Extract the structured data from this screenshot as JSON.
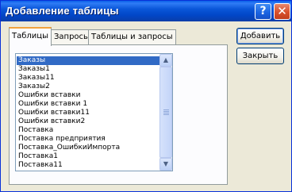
{
  "window": {
    "title": "Добавление таблицы",
    "help_label": "?",
    "close_label": "✕"
  },
  "tabs": [
    {
      "label": "Таблицы",
      "active": true
    },
    {
      "label": "Запросы",
      "active": false
    },
    {
      "label": "Таблицы и запросы",
      "active": false
    }
  ],
  "list": {
    "items": [
      "Заказы",
      "Заказы1",
      "Заказы11",
      "Заказы2",
      "Ошибки вставки",
      "Ошибки вставки 1",
      "Ошибки вставки11",
      "Ошибки вставки2",
      "Поставка",
      "Поставка предприятия",
      "Поставка_ОшибкиИмпорта",
      "Поставка1",
      "Поставка11"
    ],
    "selected_index": 0
  },
  "scrollbar": {
    "up_icon": "▲",
    "down_icon": "▼"
  },
  "buttons": {
    "add": "Добавить",
    "close": "Закрыть"
  },
  "colors": {
    "title_bar": "#0a56d8",
    "selection": "#316ac5",
    "close_button": "#d8502c",
    "active_tab_accent": "#f1a23c"
  }
}
